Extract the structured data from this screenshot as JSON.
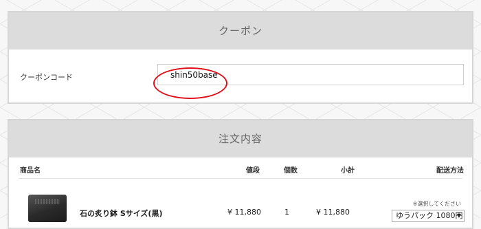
{
  "coupon": {
    "title": "クーポン",
    "label": "クーポンコード",
    "value": "shin50base"
  },
  "order": {
    "title": "注文内容",
    "columns": {
      "product": "商品名",
      "price": "値段",
      "quantity": "個数",
      "subtotal": "小計",
      "shipping": "配送方法"
    },
    "item": {
      "name": "石の炙り鉢 Sサイズ(黒)",
      "price": "¥ 11,880",
      "quantity": "1",
      "subtotal": "¥ 11,880"
    },
    "shipping": {
      "note": "※選択してください",
      "selected": "ゆうパック 1080円",
      "arrow_icon": "caret-down-icon"
    }
  },
  "colors": {
    "highlight": "#e0101a",
    "header_bg": "#dcdcdc"
  }
}
